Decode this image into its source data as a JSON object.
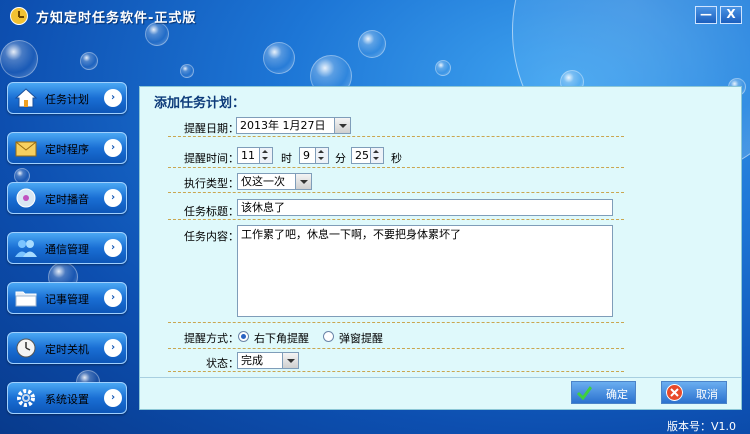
{
  "window": {
    "title": "方知定时任务软件-正式版",
    "minimize": "—",
    "close": "X"
  },
  "sidebar": {
    "items": [
      {
        "label": "任务计划",
        "icon": "home-icon"
      },
      {
        "label": "定时程序",
        "icon": "mail-icon"
      },
      {
        "label": "定时播音",
        "icon": "disc-icon"
      },
      {
        "label": "通信管理",
        "icon": "users-icon"
      },
      {
        "label": "记事管理",
        "icon": "folder-icon"
      },
      {
        "label": "定时关机",
        "icon": "clock-icon"
      },
      {
        "label": "系统设置",
        "icon": "gear-icon"
      }
    ],
    "arrow": "›"
  },
  "form": {
    "heading": "添加任务计划：",
    "date_label": "提醒日期：",
    "date_value": "2013年 1月27日",
    "time_label": "提醒时间：",
    "hour_value": "11",
    "hour_unit": "时",
    "minute_value": "9",
    "minute_unit": "分",
    "second_value": "25",
    "second_unit": "秒",
    "type_label": "执行类型：",
    "type_value": "仅这一次",
    "title_label": "任务标题：",
    "title_value": "该休息了",
    "content_label": "任务内容：",
    "content_value": "工作累了吧，休息一下啊，不要把身体累坏了",
    "remind_label": "提醒方式：",
    "remind_option1": "右下角提醒",
    "remind_option2": "弹窗提醒",
    "status_label": "状态：",
    "status_value": "完成"
  },
  "buttons": {
    "ok": "确定",
    "cancel": "取消"
  },
  "version": "版本号：V1.0",
  "colors": {
    "accent": "#1a6fd4",
    "panel": "#dff9fb",
    "divider": "#c9a650"
  }
}
